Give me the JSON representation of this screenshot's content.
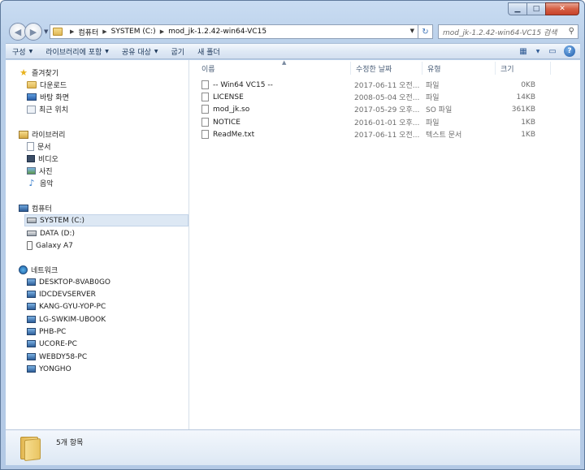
{
  "window": {
    "minimize_glyph": "▁",
    "maximize_glyph": "□",
    "close_glyph": "✕"
  },
  "address": {
    "crumbs": [
      "컴퓨터",
      "SYSTEM (C:)",
      "mod_jk-1.2.42-win64-VC15"
    ],
    "search_placeholder": "mod_jk-1.2.42-win64-VC15 검색"
  },
  "toolbar": {
    "organize": "구성",
    "add_to_library": "라이브러리에 포함",
    "share_with": "공유 대상",
    "burn": "굽기",
    "new_folder": "새 폴더"
  },
  "nav": {
    "favorites": {
      "label": "즐겨찾기",
      "items": [
        "다운로드",
        "바탕 화면",
        "최근 위치"
      ]
    },
    "libraries": {
      "label": "라이브러리",
      "items": [
        "문서",
        "비디오",
        "사진",
        "음악"
      ]
    },
    "computer": {
      "label": "컴퓨터",
      "items": [
        "SYSTEM (C:)",
        "DATA (D:)",
        "Galaxy A7"
      ]
    },
    "network": {
      "label": "네트워크",
      "items": [
        "DESKTOP-8VAB0GO",
        "IDCDEVSERVER",
        "KANG-GYU-YOP-PC",
        "LG-SWKIM-UBOOK",
        "PHB-PC",
        "UCORE-PC",
        "WEBDY58-PC",
        "YONGHO"
      ]
    }
  },
  "columns": {
    "name": "이름",
    "modified": "수정한 날짜",
    "type": "유형",
    "size": "크기"
  },
  "files": [
    {
      "name": "-- Win64 VC15  --",
      "modified": "2017-06-11 오전...",
      "type": "파일",
      "size": "0KB"
    },
    {
      "name": "LICENSE",
      "modified": "2008-05-04 오전...",
      "type": "파일",
      "size": "14KB"
    },
    {
      "name": "mod_jk.so",
      "modified": "2017-05-29 오후...",
      "type": "SO 파일",
      "size": "361KB"
    },
    {
      "name": "NOTICE",
      "modified": "2016-01-01 오후...",
      "type": "파일",
      "size": "1KB"
    },
    {
      "name": "ReadMe.txt",
      "modified": "2017-06-11 오전...",
      "type": "텍스트 문서",
      "size": "1KB"
    }
  ],
  "details": {
    "item_count": "5개 항목"
  }
}
